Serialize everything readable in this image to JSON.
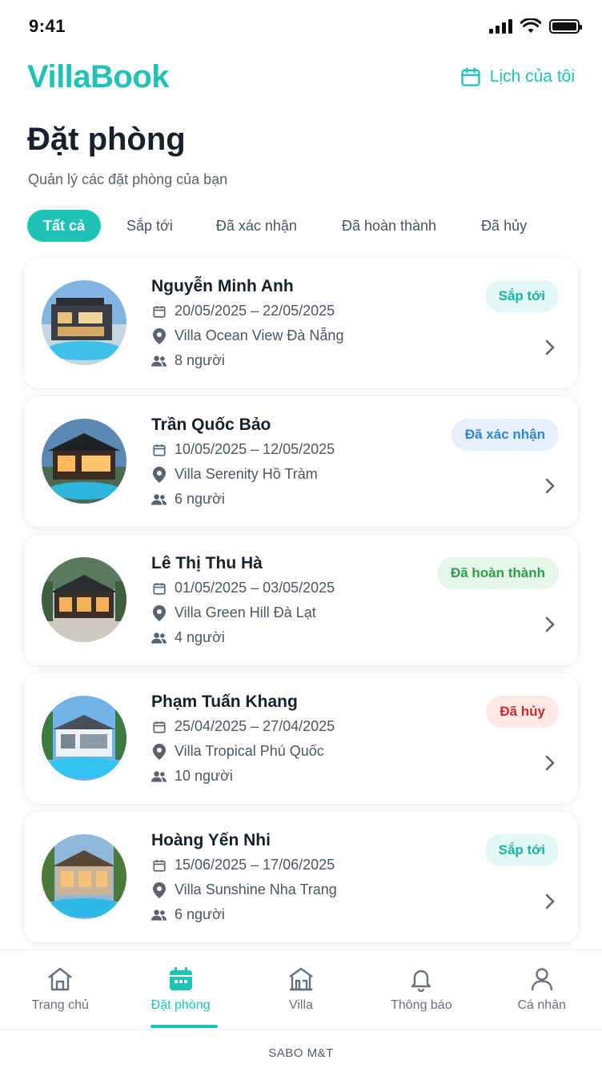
{
  "status_bar": {
    "time": "9:41"
  },
  "header": {
    "logo": "VillaBook",
    "calendar_label": "Lịch của tôi"
  },
  "page": {
    "title": "Đặt phòng",
    "subtitle": "Quản lý các đặt phòng của bạn"
  },
  "tabs": [
    {
      "label": "Tất cả",
      "active": true
    },
    {
      "label": "Sắp tới",
      "active": false
    },
    {
      "label": "Đã xác nhận",
      "active": false
    },
    {
      "label": "Đã hoàn thành",
      "active": false
    },
    {
      "label": "Đã hủy",
      "active": false
    }
  ],
  "bookings": [
    {
      "name": "Nguyễn Minh Anh",
      "dates": "20/05/2025 – 22/05/2025",
      "villa": "Villa Ocean View Đà Nẵng",
      "guests": "8 người",
      "status": "Sắp tới"
    },
    {
      "name": "Trần Quốc Bảo",
      "dates": "10/05/2025 – 12/05/2025",
      "villa": "Villa Serenity Hồ Tràm",
      "guests": "6 người",
      "status": "Đã xác nhận"
    },
    {
      "name": "Lê Thị Thu Hà",
      "dates": "01/05/2025 – 03/05/2025",
      "villa": "Villa Green Hill Đà Lạt",
      "guests": "4 người",
      "status": "Đã hoàn thành"
    },
    {
      "name": "Phạm Tuấn Khang",
      "dates": "25/04/2025 – 27/04/2025",
      "villa": "Villa Tropical Phú Quốc",
      "guests": "10 người",
      "status": "Đã hủy"
    },
    {
      "name": "Hoàng Yến Nhi",
      "dates": "15/06/2025 – 17/06/2025",
      "villa": "Villa Sunshine Nha Trang",
      "guests": "6 người",
      "status": "Sắp tới"
    }
  ],
  "bottom_nav": [
    {
      "label": "Trang chủ",
      "icon": "home-icon"
    },
    {
      "label": "Đặt phòng",
      "icon": "calendar-icon",
      "active": true
    },
    {
      "label": "Villa",
      "icon": "villa-icon"
    },
    {
      "label": "Thông báo",
      "icon": "bell-icon"
    },
    {
      "label": "Cá nhân",
      "icon": "user-icon"
    }
  ],
  "footer": {
    "text": "SABO M&T"
  },
  "colors": {
    "accent": "#1ec3b6",
    "text": "#1a1f2c"
  }
}
